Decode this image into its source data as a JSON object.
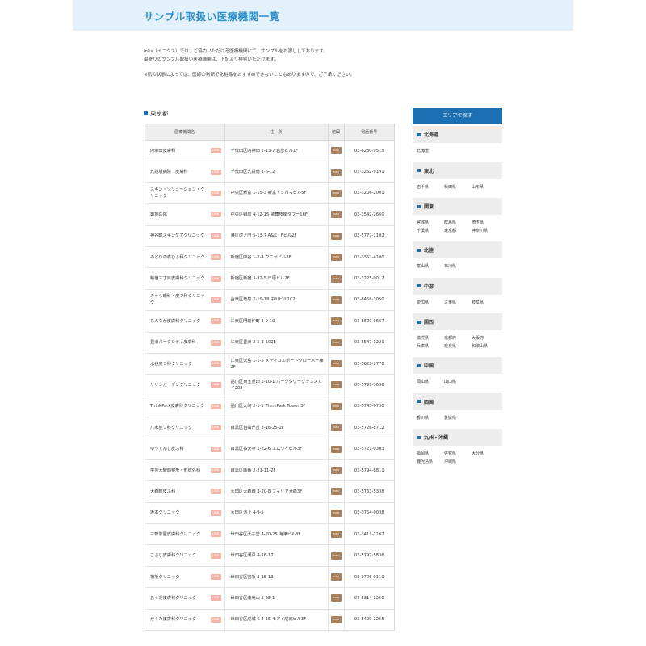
{
  "header": {
    "title": "サンプル取扱い医療機関一覧"
  },
  "intro": {
    "line1": "inks（イニクス）では、ご協力いただける医療機関にて、サンプルをお渡ししております。",
    "line2": "最寄りのサンプル取扱い医療機関は、下記より検索いただけます。",
    "note": "※肌の状態によっては、医師の判断で化粧品をおすすめできないこともありますので、ご了承ください。"
  },
  "section": {
    "title": "東京都"
  },
  "table": {
    "headers": [
      "医療機関名",
      "住　所",
      "地図",
      "電話番号"
    ],
    "link_label": "LINK",
    "map_label": "map",
    "rows": [
      {
        "name": "内幸田皮膚科",
        "address": "千代田区内神田 2-13-7 岩彦ビル1F",
        "tel": "03-6280-9515"
      },
      {
        "name": "九段坂病院　皮膚科",
        "address": "千代田区九段南 1-6-12",
        "tel": "03-3262-9191"
      },
      {
        "name": "スキン・ソリューション・クリニック",
        "address": "中央区新富 1-15-3 新富・ミハマビル5F",
        "tel": "03-3206-2001"
      },
      {
        "name": "築地医院",
        "address": "中央区銀座 4-12-15 歌舞伎座タワー16F",
        "tel": "03-3542-2660"
      },
      {
        "name": "神谷町スキンケアクリニック",
        "address": "港区虎ノ門 5-13-7 A&K・Fビル2F",
        "tel": "03-5777-1102"
      },
      {
        "name": "みどりの森ひふ科クリニック",
        "address": "新宿区四谷 1-2-4 クニヤビル3F",
        "tel": "03-3352-4100"
      },
      {
        "name": "新宿三丁目皮膚科クリニック",
        "address": "新宿区新宿 3-32-5 日原ビル2F",
        "tel": "03-3225-0017"
      },
      {
        "name": "みうら眼科・皮フ科クリニック",
        "address": "台東区竜泉 2-19-18 中川ビル102",
        "tel": "03-6458-1050"
      },
      {
        "name": "もんなか皮膚科クリニック",
        "address": "江東区門前仲町 1-9-10",
        "tel": "03-5620-0667"
      },
      {
        "name": "豊洲パークシティ皮膚科",
        "address": "江東区豊洲 2-5-3-102E",
        "tel": "03-5547-1221"
      },
      {
        "name": "水谷皮フ科クリニック",
        "address": "江東区大島 1-1-5 メディカルポートクローバー棟2F",
        "tel": "03-5629-2770"
      },
      {
        "name": "サザンガーデンクリニック",
        "address": "品川区東五反田 2-10-1 パークタワーグランスカイ202",
        "tel": "03-5791-3636"
      },
      {
        "name": "ThinkPark皮膚科クリニック",
        "address": "品川区大崎 2-1-1 ThinkPark Tower 3F",
        "tel": "03-5745-0730"
      },
      {
        "name": "八木皮フ科クリニック",
        "address": "目黒区自由が丘 2-16-25-2F",
        "tel": "03-5726-8712"
      },
      {
        "name": "ゆうてんじ皮ふ科",
        "address": "目黒区祐天寺 1-22-6 エムワイビル3F",
        "tel": "03-5721-0303"
      },
      {
        "name": "学芸大駅前整形・形成外科",
        "address": "目黒区鷹番 2-21-11-2F",
        "tel": "03-5794-8811"
      },
      {
        "name": "大森町皮ふ科",
        "address": "大田区大森西 3-20-8 フィリア大森3F",
        "tel": "03-5763-5338"
      },
      {
        "name": "坂本クリニック",
        "address": "大田区池上 4-9-5",
        "tel": "03-3754-0038"
      },
      {
        "name": "三軒茶屋皮膚科クリニック",
        "address": "世田谷区太子堂 4-20-25 海津ビル3F",
        "tel": "03-3411-1167"
      },
      {
        "name": "こぶし皮膚科クリニック",
        "address": "世田谷区瀬戸 4-16-17",
        "tel": "03-5797-5836"
      },
      {
        "name": "横坂クリニック",
        "address": "世田谷区宮坂 3-15-13",
        "tel": "03-3706-9111"
      },
      {
        "name": "おくだ皮膚科クリニック",
        "address": "世田谷区南烏山 5-28-1",
        "tel": "03-5314-1250"
      },
      {
        "name": "かくた皮膚科クリニック",
        "address": "世田谷区成城 6-4-15 モアイ成城ビル3F",
        "tel": "03-5429-2255"
      }
    ]
  },
  "area": {
    "title": "エリアで探す",
    "regions": [
      {
        "name": "北海道",
        "prefs": [
          "北海道"
        ]
      },
      {
        "name": "東北",
        "prefs": [
          "岩手県",
          "秋田県",
          "山形県"
        ]
      },
      {
        "name": "関東",
        "prefs": [
          "宮城県",
          "群馬県",
          "埼玉県",
          "千葉県",
          "東京都",
          "神奈川県"
        ]
      },
      {
        "name": "北陸",
        "prefs": [
          "富山県",
          "石川県"
        ]
      },
      {
        "name": "中部",
        "prefs": [
          "愛知県",
          "三重県",
          "岐阜県"
        ]
      },
      {
        "name": "関西",
        "prefs": [
          "滋賀県",
          "京都府",
          "大阪府",
          "兵庫県",
          "奈良県",
          "和歌山県"
        ]
      },
      {
        "name": "中国",
        "prefs": [
          "岡山県",
          "山口県"
        ]
      },
      {
        "name": "四国",
        "prefs": [
          "香川県",
          "愛媛県"
        ]
      },
      {
        "name": "九州・沖縄",
        "prefs": [
          "福岡県",
          "佐賀県",
          "大分県",
          "鹿児島県",
          "沖縄県"
        ]
      }
    ]
  },
  "colors": {
    "accent": "#1c6fb0",
    "header_bg": "#e2f1fb",
    "title": "#2f8fc9",
    "link_badge": "#f2b3a8",
    "map_badge": "#a8805c"
  }
}
